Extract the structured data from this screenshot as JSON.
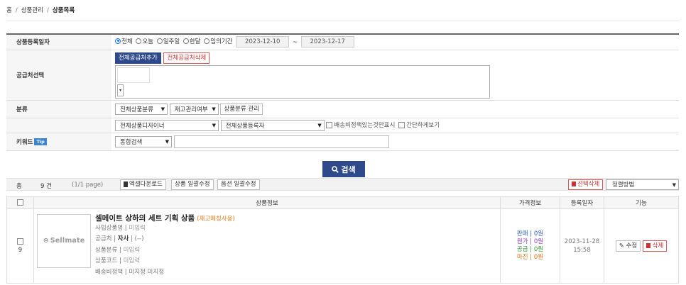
{
  "breadcrumb": {
    "home": "홈",
    "section": "상품관리",
    "current": "상품목록"
  },
  "form": {
    "date_label": "상품등록일자",
    "date_options": [
      "전체",
      "오늘",
      "일주일",
      "한달",
      "임의기간"
    ],
    "date_from": "2023-12-10",
    "date_to": "2023-12-17",
    "date_sep": "~",
    "supplier_label": "공급처선택",
    "supplier_add": "전체공급처추가",
    "supplier_delete": "전체공급처삭제",
    "category_label": "분류",
    "category_select": "전체상품분류",
    "stock_select": "재고관리여부",
    "category_manage": "상품분류 관리",
    "designer_select": "전체상품디자이너",
    "registrant_select": "전체상품등록자",
    "shipping_check": "배송비정책있는것만표시",
    "simple_check": "간단하게보기",
    "keyword_label": "키워드",
    "tip": "Tip",
    "keyword_select": "통합검색",
    "keyword_value": ""
  },
  "search_button": "검색",
  "toolbar": {
    "total_label": "총",
    "count": "9 건",
    "page": "(1/1 page)",
    "excel": "엑셀다운로드",
    "bulk_product": "상품 일괄수정",
    "bulk_option": "옵션 일괄수정",
    "delete_selected": "선택삭제",
    "sort_select": "정렬방법"
  },
  "table": {
    "headers": {
      "info": "상품정보",
      "price": "가격정보",
      "date": "등록일자",
      "func": "기능"
    },
    "rows": [
      {
        "num": "9",
        "thumb": "Sellmate",
        "name": "셀메이트 상하의 세트 기획 상품",
        "memo": "(재고매칭사용)",
        "biz_label": "사입상품명",
        "biz_val": "미입력",
        "supplier_label": "공급처",
        "supplier_val": "자사",
        "supplier_extra": "(--)",
        "category_label": "상품분류",
        "category_val": "미입력",
        "code_label": "상품코드",
        "code_val": "미입력",
        "ship_label": "배송비정책",
        "ship_val": "미지정 미지정",
        "price_sale": "판매 | 0원",
        "price_cost": "원가 | 0원",
        "price_supply": "공급 | 0원",
        "price_margin": "마진 | 0원",
        "date": "2023-11-28",
        "time": "15:58",
        "edit": "수정",
        "delete": "삭제"
      }
    ]
  }
}
